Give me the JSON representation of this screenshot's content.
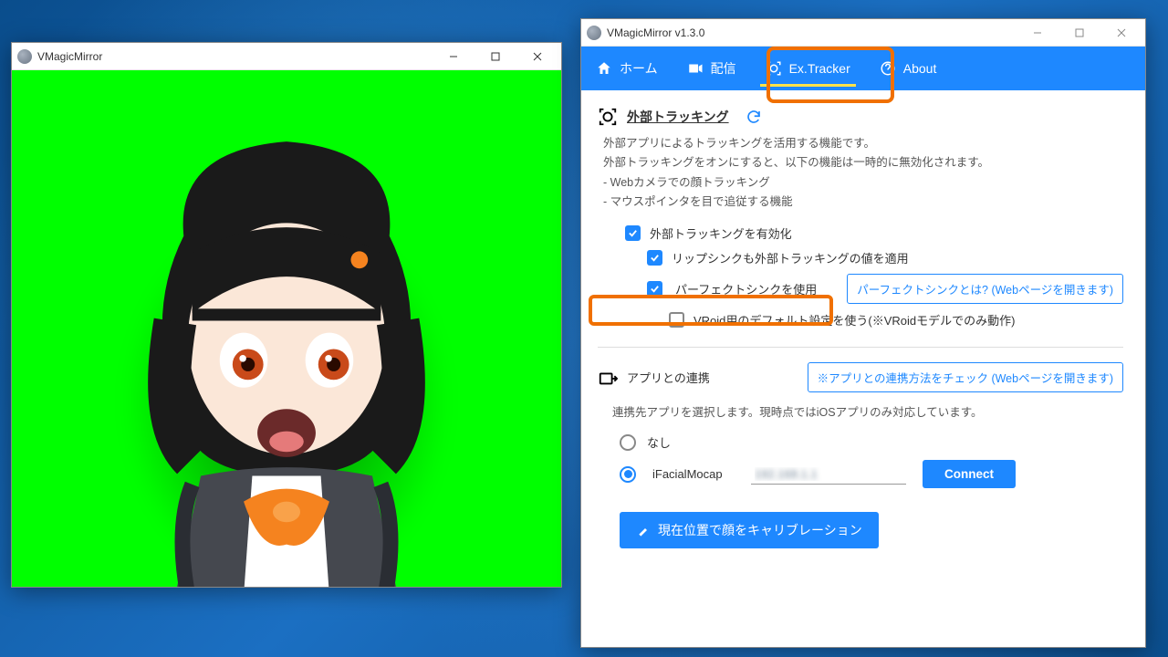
{
  "left_window": {
    "title": "VMagicMirror"
  },
  "right_window": {
    "title": "VMagicMirror v1.3.0",
    "tabs": {
      "home": "ホーム",
      "stream": "配信",
      "extracker": "Ex.Tracker",
      "about": "About"
    }
  },
  "ext_tracking": {
    "heading": "外部トラッキング",
    "desc_line1": "外部アプリによるトラッキングを活用する機能です。",
    "desc_line2": "外部トラッキングをオンにすると、以下の機能は一時的に無効化されます。",
    "desc_line3": "- Webカメラでの顔トラッキング",
    "desc_line4": "- マウスポインタを目で追従する機能",
    "chk_enable": "外部トラッキングを有効化",
    "chk_lipsync": "リップシンクも外部トラッキングの値を適用",
    "chk_perfect": "パーフェクトシンクを使用",
    "btn_perfect_help": "パーフェクトシンクとは? (Webページを開きます)",
    "chk_vroid": "VRoid用のデフォルト設定を使う(※VRoidモデルでのみ動作)"
  },
  "app_link": {
    "heading": "アプリとの連携",
    "btn_help": "※アプリとの連携方法をチェック (Webページを開きます)",
    "desc": "連携先アプリを選択します。現時点ではiOSアプリのみ対応しています。",
    "radio_none": "なし",
    "radio_ifm": "iFacialMocap",
    "ip_value": "192.168.1.1",
    "btn_connect": "Connect",
    "btn_calibrate": "現在位置で顔をキャリブレーション"
  }
}
